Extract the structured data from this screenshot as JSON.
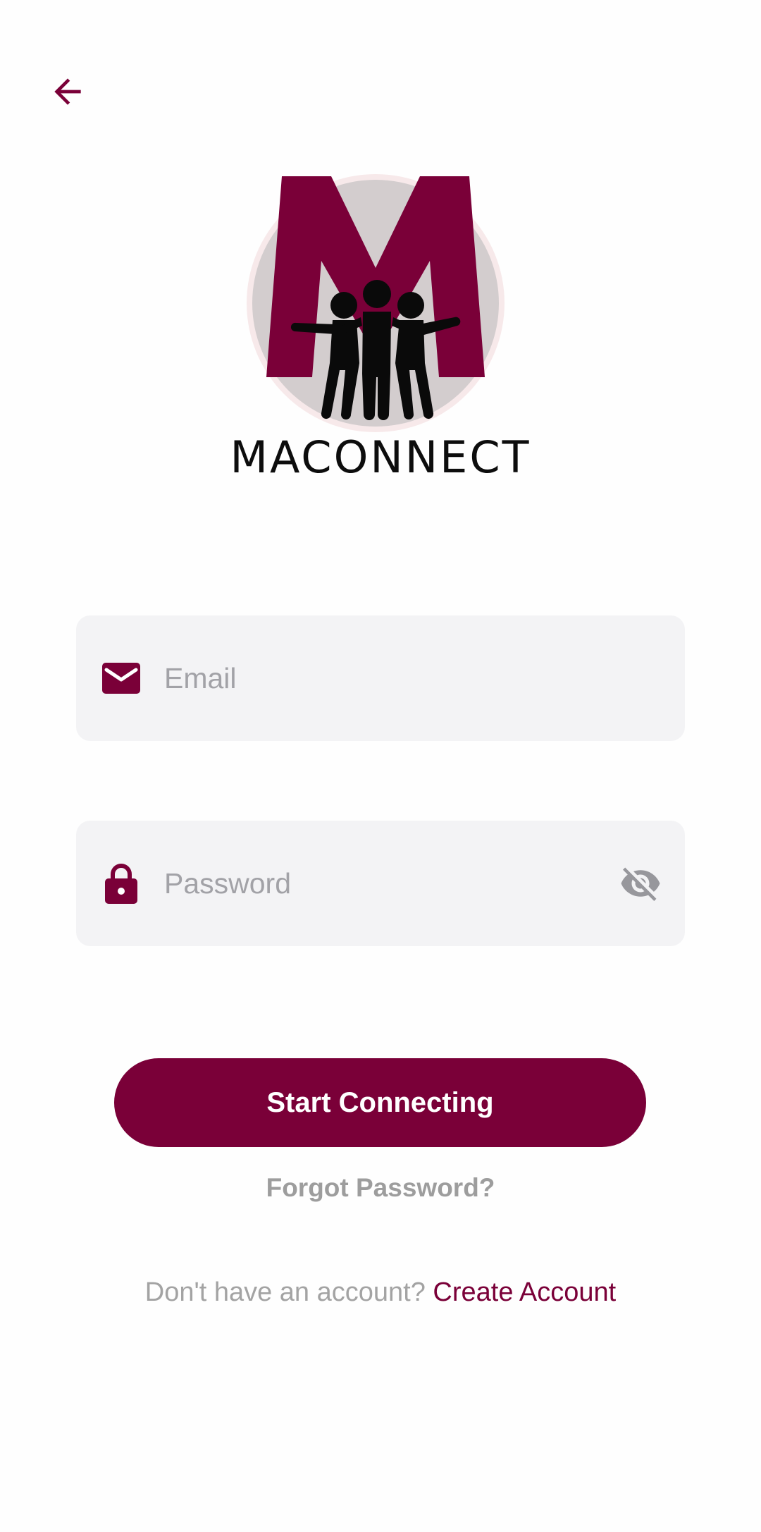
{
  "nav": {
    "back_icon": "arrow-left-icon"
  },
  "brand": {
    "logo_text": "MACONNECT",
    "colors": {
      "primary": "#7a0038",
      "logo_circle": "#d3cdce",
      "figures": "#0a0a0a"
    }
  },
  "form": {
    "email": {
      "placeholder": "Email",
      "value": "",
      "icon": "envelope-icon"
    },
    "password": {
      "placeholder": "Password",
      "value": "",
      "icon": "lock-icon",
      "toggle_icon": "eye-off-icon"
    }
  },
  "actions": {
    "submit_label": "Start Connecting",
    "forgot_label": "Forgot Password?",
    "signup_prompt": "Don't have an account?",
    "signup_link": "Create Account"
  },
  "colors": {
    "accent": "#7a0038",
    "field_bg": "#f3f3f5",
    "placeholder": "#a2a2a7",
    "muted_text": "#a3a3a3"
  }
}
